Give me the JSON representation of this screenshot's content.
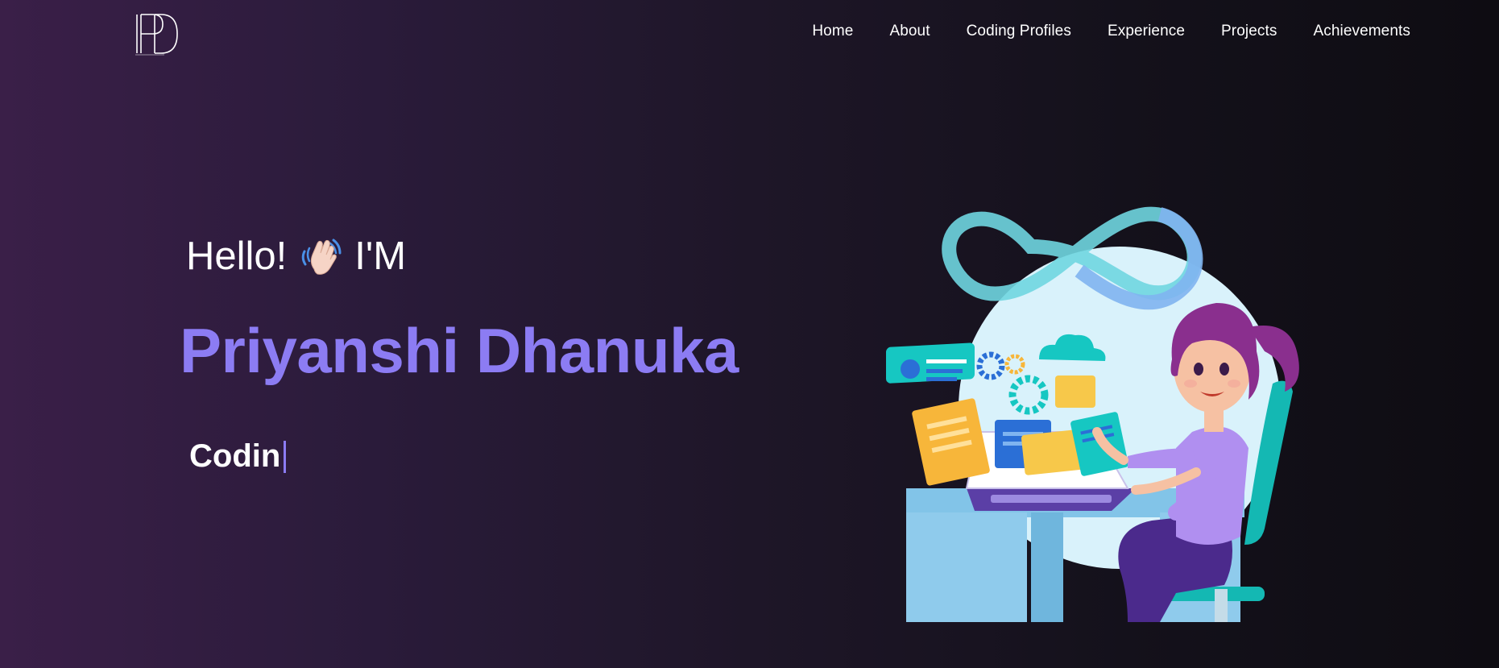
{
  "nav": {
    "logo_icon": "pd-monogram-logo",
    "links": [
      {
        "label": "Home"
      },
      {
        "label": "About"
      },
      {
        "label": "Coding Profiles"
      },
      {
        "label": "Experience"
      },
      {
        "label": "Projects"
      },
      {
        "label": "Achievements"
      }
    ]
  },
  "hero": {
    "greeting_prefix": "Hello!",
    "greeting_icon": "waving-hand-icon",
    "greeting_suffix": "I'M",
    "name": "Priyanshi Dhanuka",
    "typed_text": "Codin",
    "illustration": "developer-girl-at-laptop-illustration"
  },
  "colors": {
    "accent": "#8c7cf3",
    "bg_left": "#3a1f48",
    "bg_right": "#0e0c12",
    "text": "#ffffff"
  }
}
